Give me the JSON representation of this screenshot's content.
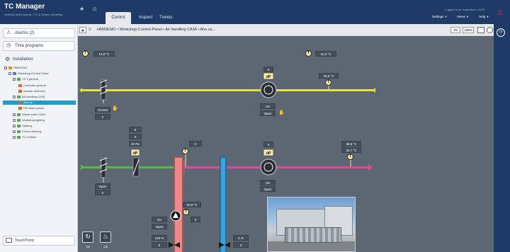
{
  "app": {
    "title": "TC Manager",
    "subtitle": "Amenity Unit Controls / TC & Sensor Modeling",
    "tabs": [
      "Control",
      "Inspect",
      "Trends"
    ],
    "active_tab": "Control",
    "login_text": "Logged in as: supervisor | 1679",
    "menus": [
      "Settings",
      "Views",
      "Help"
    ]
  },
  "sidebar": {
    "alarms": "Alarms (2)",
    "time_programs": "Time programs",
    "installation": "Installation",
    "tree": [
      {
        "label": "HMIDEMO",
        "level": 0
      },
      {
        "label": "Workshop-Control Panel",
        "level": 1
      },
      {
        "label": "CP 2 general",
        "level": 2
      },
      {
        "label": "Controller general",
        "level": 3
      },
      {
        "label": "Intruder detection",
        "level": 3
      },
      {
        "label": "Air handling CA34",
        "level": 2
      },
      {
        "label": "Ahu ca...",
        "level": 3,
        "selected": true
      },
      {
        "label": "Fire alarm panel",
        "level": 3
      },
      {
        "label": "Waste water CA34",
        "level": 2
      },
      {
        "label": "Workshop lighting",
        "level": 2
      },
      {
        "label": "Heating",
        "level": 2
      },
      {
        "label": "Freez metering",
        "level": 2
      },
      {
        "label": "TC 8 Office",
        "level": 2
      }
    ],
    "touchpoints": "TouchPoints"
  },
  "breadcrumb": "HMIDEMO • Workshop-Control-Panel • Air handling CA34 • Ahu ca...",
  "toolbar": {
    "fit": "Fit",
    "zoom": "100%"
  },
  "diagram": {
    "outside_temp": "14,8 °C",
    "return_temp": "22,3 °C",
    "exhaust_dp": "0",
    "exhaust_temp": "20,5 °C",
    "exhaust_fan_status": "On",
    "exhaust_fan_mode": "Open",
    "exhaust_damper_status": "Closed",
    "exhaust_damper_value": "0",
    "filter_val1": "0",
    "filter_val2": "0",
    "filter_pa": "22 Pa",
    "heat_recovery_val": "0",
    "supply_dp": "0",
    "supply_fan_status": "On",
    "supply_fan_mode": "Open",
    "supply_temp1": "38,9 °C",
    "supply_temp2": "32,7 °C",
    "supply_damper_status": "Open",
    "supply_damper_value": "0",
    "heating_temp": "62,8 °C",
    "heating_val": "0",
    "pump_status": "On",
    "pump_mode": "Open",
    "heating_valve_pct": "100 %",
    "heating_valve_val": "0",
    "cooling_valve_pct": "0 %",
    "cooling_valve_val": "0",
    "panel_btn1_label": "Off",
    "panel_btn2_label": "Off"
  },
  "colors": {
    "header": "#1e3a66",
    "exhaust_duct": "#e6df3e",
    "supply_cold": "#4fbf3f",
    "supply_hot": "#e8449a",
    "heating_pipe": "#f08888",
    "cooling_pipe": "#3aa4d8",
    "canvas": "#5d6774",
    "selected": "#1e9fc5"
  }
}
